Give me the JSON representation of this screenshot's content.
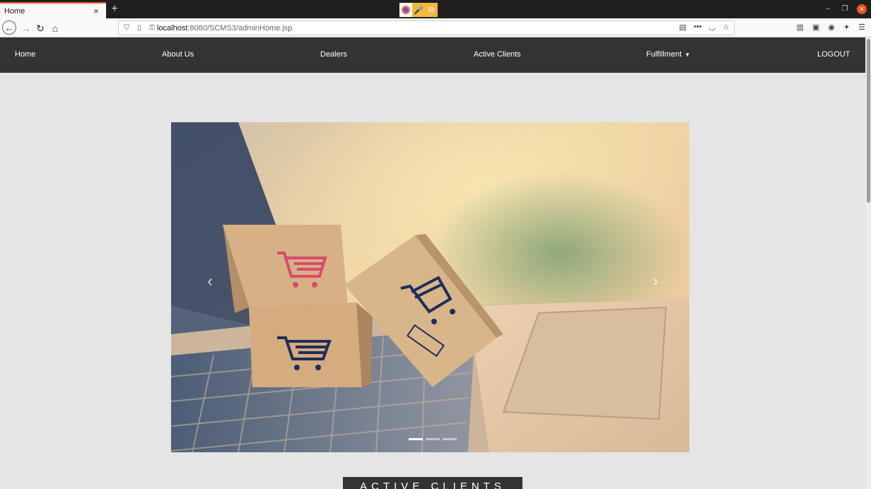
{
  "browser": {
    "tab_title": "Home",
    "tab_close": "×",
    "new_tab": "+",
    "url_host": "localhost",
    "url_path": ":8080/SCMS3/adminHome.jsp"
  },
  "site_nav": {
    "items": [
      {
        "label": "Home"
      },
      {
        "label": "About Us"
      },
      {
        "label": "Dealers"
      },
      {
        "label": "Active Clients"
      },
      {
        "label": "Fulfillment",
        "has_dropdown": true
      },
      {
        "label": "LOGOUT"
      }
    ]
  },
  "carousel": {
    "prev_icon": "chevron-left-icon",
    "next_icon": "chevron-right-icon",
    "slide_count": 3,
    "active_index": 0
  },
  "section": {
    "button_label": "ACTIVE CLIENTS"
  },
  "colors": {
    "nav_bg": "#333333",
    "page_bg": "#e5e5e5",
    "cart_pink": "#d94a6e",
    "cart_navy": "#1f2d5c"
  }
}
